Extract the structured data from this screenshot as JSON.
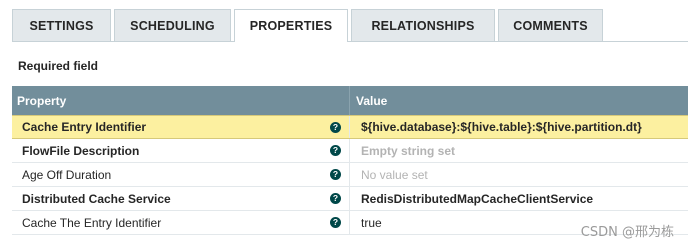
{
  "tabs": [
    {
      "label": "SETTINGS",
      "active": false
    },
    {
      "label": "SCHEDULING",
      "active": false
    },
    {
      "label": "PROPERTIES",
      "active": true
    },
    {
      "label": "RELATIONSHIPS",
      "active": false
    },
    {
      "label": "COMMENTS",
      "active": false
    }
  ],
  "required_label": "Required field",
  "table": {
    "headers": {
      "property": "Property",
      "value": "Value"
    },
    "rows": [
      {
        "property": "Cache Entry Identifier",
        "value": "${hive.database}:${hive.table}:${hive.partition.dt}",
        "required": true,
        "selected": true,
        "value_state": "set"
      },
      {
        "property": "FlowFile Description",
        "value": "Empty string set",
        "required": true,
        "selected": false,
        "value_state": "empty"
      },
      {
        "property": "Age Off Duration",
        "value": "No value set",
        "required": false,
        "selected": false,
        "value_state": "unset"
      },
      {
        "property": "Distributed Cache Service",
        "value": "RedisDistributedMapCacheClientService",
        "required": true,
        "selected": false,
        "value_state": "set"
      },
      {
        "property": "Cache The Entry Identifier",
        "value": "true",
        "required": false,
        "selected": false,
        "value_state": "set-plain"
      }
    ],
    "help_icon": "question-circle-icon",
    "help_glyph": "?"
  },
  "watermark": "CSDN @邢为栋",
  "colors": {
    "header_bg": "#728e9b",
    "selected_row_bg": "#fcf0a0",
    "help_icon_bg": "#004849",
    "tab_bg": "#e3e8eb"
  }
}
